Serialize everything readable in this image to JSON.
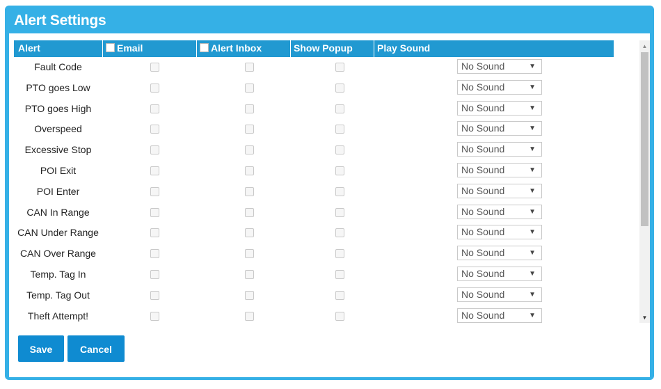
{
  "dialog": {
    "title": "Alert Settings"
  },
  "table": {
    "headers": {
      "alert": "Alert",
      "email": "Email",
      "alert_inbox": "Alert Inbox",
      "show_popup": "Show Popup",
      "play_sound": "Play Sound"
    },
    "rows": [
      {
        "label": "Fault Code",
        "sound": "No Sound"
      },
      {
        "label": "PTO goes Low",
        "sound": "No Sound"
      },
      {
        "label": "PTO goes High",
        "sound": "No Sound"
      },
      {
        "label": "Overspeed",
        "sound": "No Sound"
      },
      {
        "label": "Excessive Stop",
        "sound": "No Sound"
      },
      {
        "label": "POI Exit",
        "sound": "No Sound"
      },
      {
        "label": "POI Enter",
        "sound": "No Sound"
      },
      {
        "label": "CAN In Range",
        "sound": "No Sound"
      },
      {
        "label": "CAN Under Range",
        "sound": "No Sound"
      },
      {
        "label": "CAN Over Range",
        "sound": "No Sound"
      },
      {
        "label": "Temp. Tag In",
        "sound": "No Sound"
      },
      {
        "label": "Temp. Tag Out",
        "sound": "No Sound"
      },
      {
        "label": "Theft Attempt!",
        "sound": "No Sound"
      }
    ]
  },
  "buttons": {
    "save": "Save",
    "cancel": "Cancel"
  },
  "icons": {
    "dropdown": "chevron-down-icon",
    "scroll_up": "scroll-up-arrow-icon",
    "scroll_down": "scroll-down-arrow-icon"
  },
  "colors": {
    "dialog_frame": "#35b0e6",
    "header_bg": "#2199d1",
    "button_bg": "#0f8bd1"
  }
}
